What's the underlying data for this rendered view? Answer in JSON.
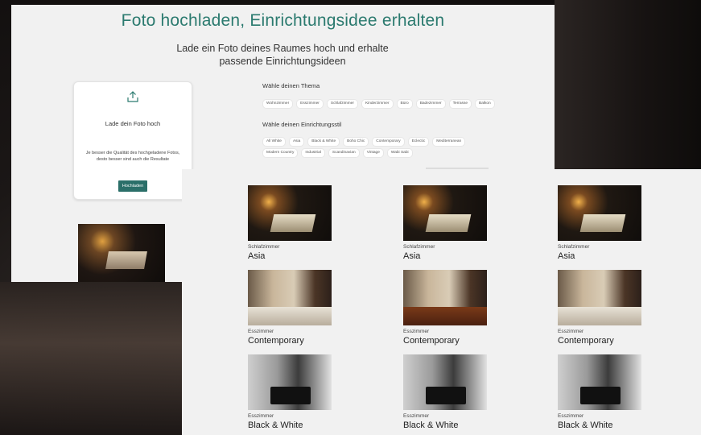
{
  "main": {
    "title": "Foto hochladen, Einrichtungsidee erhalten",
    "subtitle": "Lade ein Foto deines Raumes hoch und erhalte passende Einrichtungsideen"
  },
  "upload": {
    "icon": "upload-icon",
    "title": "Lade dein Foto hoch",
    "hint": "Je besser die Qualität des hochgeladene Fotos, desto besser sind auch die Resultate",
    "button": "Hochladen"
  },
  "theme": {
    "label": "Wähle deinen Thema",
    "options": [
      "Wohnzimmer",
      "Esszimmer",
      "Schlafzimmer",
      "Kinderzimmer",
      "Büro",
      "Badezimmer",
      "Terrasse",
      "Balkon"
    ]
  },
  "style": {
    "label": "Wähle deinen Einrichtungsstil",
    "options_row1": [
      "All White",
      "Asia",
      "Black & White",
      "Boho Chic",
      "Contemporary",
      "Eclectic",
      "Mediterranean"
    ],
    "options_row2": [
      "Modern Country",
      "Industrial",
      "Scandinavian",
      "Vintage",
      "Wabi Sabi"
    ]
  },
  "results": [
    {
      "category": "Schlafzimmer",
      "style": "Asia"
    },
    {
      "category": "Schlafzimmer",
      "style": "Asia"
    },
    {
      "category": "Schlafzimmer",
      "style": "Asia"
    },
    {
      "category": "Esszimmer",
      "style": "Contemporary"
    },
    {
      "category": "Esszimmer",
      "style": "Contemporary"
    },
    {
      "category": "Esszimmer",
      "style": "Contemporary"
    },
    {
      "category": "Esszimmer",
      "style": "Black & White"
    },
    {
      "category": "Esszimmer",
      "style": "Black & White"
    },
    {
      "category": "Esszimmer",
      "style": "Black & White"
    }
  ],
  "colors": {
    "accent": "#2b7a6f",
    "button": "#2b6f69"
  }
}
